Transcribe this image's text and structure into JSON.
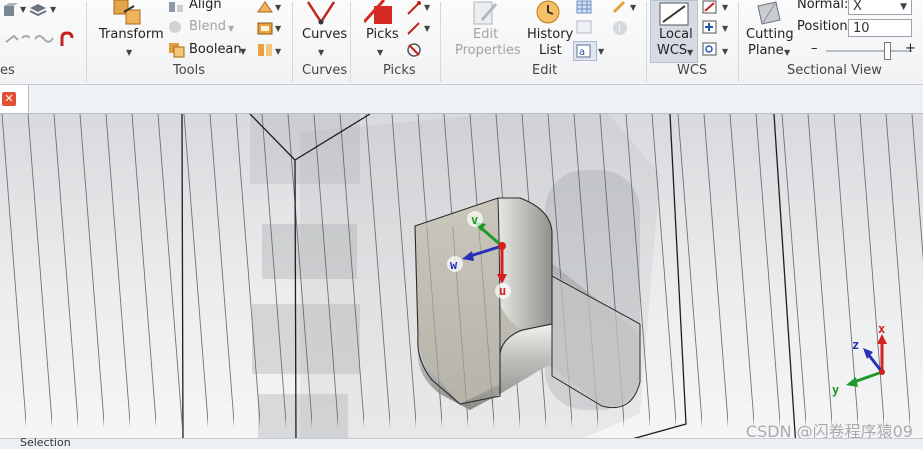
{
  "ribbon": {
    "tools": {
      "transform": "Transform",
      "align": "Align",
      "blend": "Blend",
      "boolean": "Boolean",
      "group": "Tools"
    },
    "curves": {
      "button": "Curves",
      "group": "Curves"
    },
    "picks": {
      "button": "Picks",
      "group": "Picks"
    },
    "edit": {
      "edit_properties_1": "Edit",
      "edit_properties_2": "Properties",
      "history_1": "History",
      "history_2": "List",
      "group": "Edit"
    },
    "wcs": {
      "local_1": "Local",
      "local_2": "WCS",
      "group": "WCS"
    },
    "cutting_plane": {
      "line1": "Cutting",
      "line2": "Plane"
    },
    "sectional": {
      "normal_label": "Normal:",
      "normal_value": "X",
      "position_label": "Position:",
      "position_value": "10",
      "slider_minus": "–",
      "slider_plus": "+",
      "group": "Sectional View"
    },
    "left_group_fragment": "es"
  },
  "tab": {
    "close_glyph": "✕"
  },
  "viewport": {
    "local_axes": {
      "u": "u",
      "v": "v",
      "w": "w"
    },
    "global_axes": {
      "x": "x",
      "y": "y",
      "z": "z"
    },
    "colors": {
      "u_axis": "#d42020",
      "v_axis": "#1f9a2a",
      "w_axis": "#2630b8"
    },
    "watermark": "CSDN @闪卷程序猿09"
  },
  "status": {
    "text": "Selection"
  }
}
